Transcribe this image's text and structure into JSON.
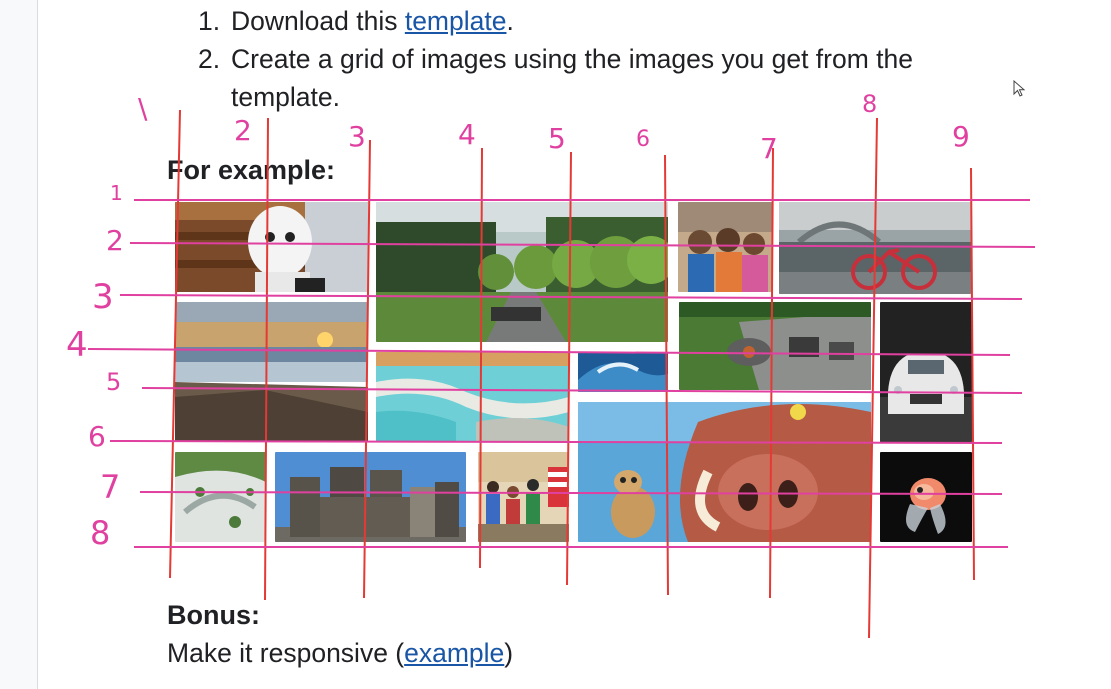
{
  "steps": [
    {
      "num": "1.",
      "text": "Download this ",
      "link": "template",
      "after": "."
    },
    {
      "num": "2.",
      "text": "Create a grid of images using the images you get from the template.",
      "link": "",
      "after": ""
    }
  ],
  "example_heading": "For example:",
  "bonus": {
    "heading": "Bonus:",
    "text_before": "Make it responsive (",
    "link": "example",
    "text_after": ")"
  },
  "grid_images": [
    {
      "name": "robot",
      "icon": "robot-photo"
    },
    {
      "name": "tree-avenue",
      "icon": "tree-avenue-photo"
    },
    {
      "name": "kids",
      "icon": "kids-photo"
    },
    {
      "name": "canal-bike",
      "icon": "canal-bike-photo"
    },
    {
      "name": "sunset-coast",
      "icon": "sunset-coast-photo"
    },
    {
      "name": "garden-patio",
      "icon": "garden-patio-photo"
    },
    {
      "name": "white-car",
      "icon": "white-car-photo"
    },
    {
      "name": "turquoise-pools",
      "icon": "turquoise-pools-photo"
    },
    {
      "name": "wave",
      "icon": "wave-photo"
    },
    {
      "name": "meerkat-warthog",
      "icon": "cartoon-photo"
    },
    {
      "name": "aerial-park",
      "icon": "aerial-park-photo"
    },
    {
      "name": "castle",
      "icon": "castle-photo"
    },
    {
      "name": "crowd",
      "icon": "crowd-photo"
    },
    {
      "name": "goldfish",
      "icon": "goldfish-photo"
    }
  ],
  "annotation_colors": {
    "vertical": "#e53935",
    "horizontal": "#e040a0",
    "number": "#e040a0"
  },
  "column_numbers": [
    "\\",
    "2",
    "3",
    "4",
    "5",
    "6",
    "7",
    "8",
    "9"
  ],
  "row_numbers": [
    "1",
    "2",
    "3",
    "4",
    "5",
    "6",
    "7",
    "8"
  ]
}
